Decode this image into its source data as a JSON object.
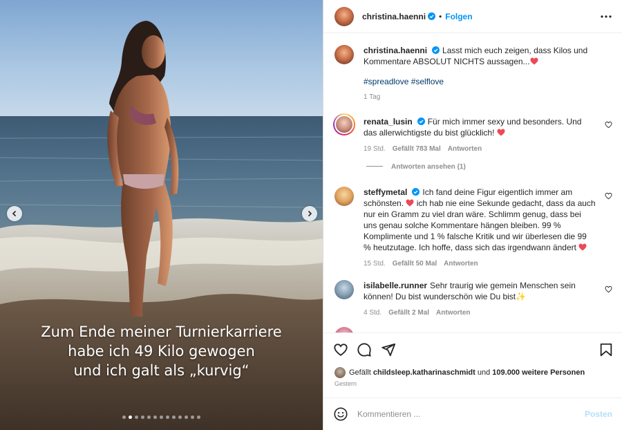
{
  "post": {
    "author": "christina.haenni",
    "follow_label": "Folgen",
    "separator": "•",
    "caption_text": "Lasst mich euch zeigen, dass Kilos und Kommentare ABSOLUT NICHTS aussagen...",
    "hashtags": "#spreadlove #selflove",
    "time_ago": "1 Tag",
    "image_overlay_lines": [
      "Zum Ende meiner Turnierkarriere",
      "habe ich 49 Kilo gewogen",
      "und ich galt als „kurvig“"
    ],
    "carousel": {
      "total_slides": 13,
      "active_slide": 2
    }
  },
  "comments": [
    {
      "user": "renata_lusin",
      "verified": true,
      "text": "Für mich immer sexy und besonders. Und das allerwichtigste du bist glücklich!",
      "time": "19 Std.",
      "likes": "Gefällt 783 Mal",
      "reply_label": "Antworten",
      "view_replies": "Antworten ansehen (1)"
    },
    {
      "user": "steffymetal",
      "verified": true,
      "text_a": "Ich fand deine Figur eigentlich immer am schönsten.",
      "text_b": "ich hab nie eine Sekunde gedacht, dass da auch nur ein Gramm zu viel dran wäre. Schlimm genug, dass bei uns genau solche Kommentare hängen bleiben. 99 % Komplimente und 1 % falsche Kritik und wir überlesen die 99 % heutzutage. Ich hoffe, dass sich das irgendwann ändert",
      "time": "15 Std.",
      "likes": "Gefällt 50 Mal",
      "reply_label": "Antworten"
    },
    {
      "user": "isilabelle.runner",
      "verified": false,
      "text": "Sehr traurig wie gemein Menschen sein können! Du bist wunderschön wie Du bist",
      "time": "4 Std.",
      "likes": "Gefällt 2 Mal",
      "reply_label": "Antworten"
    }
  ],
  "likes_summary": {
    "prefix": "Gefällt",
    "users": "childsleep.katharinaschmidt",
    "middle": "und",
    "others": "109.000 weitere Personen",
    "date": "Gestern"
  },
  "composer": {
    "placeholder": "Kommentieren ...",
    "post_label": "Posten"
  },
  "icons": {
    "verified": "verified-badge-icon",
    "more": "more-options-icon",
    "like": "heart-icon",
    "comment": "comment-icon",
    "share": "share-icon",
    "save": "bookmark-icon",
    "emoji": "emoji-icon"
  },
  "colors": {
    "accent": "#0095f6",
    "hashtag": "#00376b",
    "muted": "#8e8e8e",
    "heart_emoji": "#ed4956"
  }
}
